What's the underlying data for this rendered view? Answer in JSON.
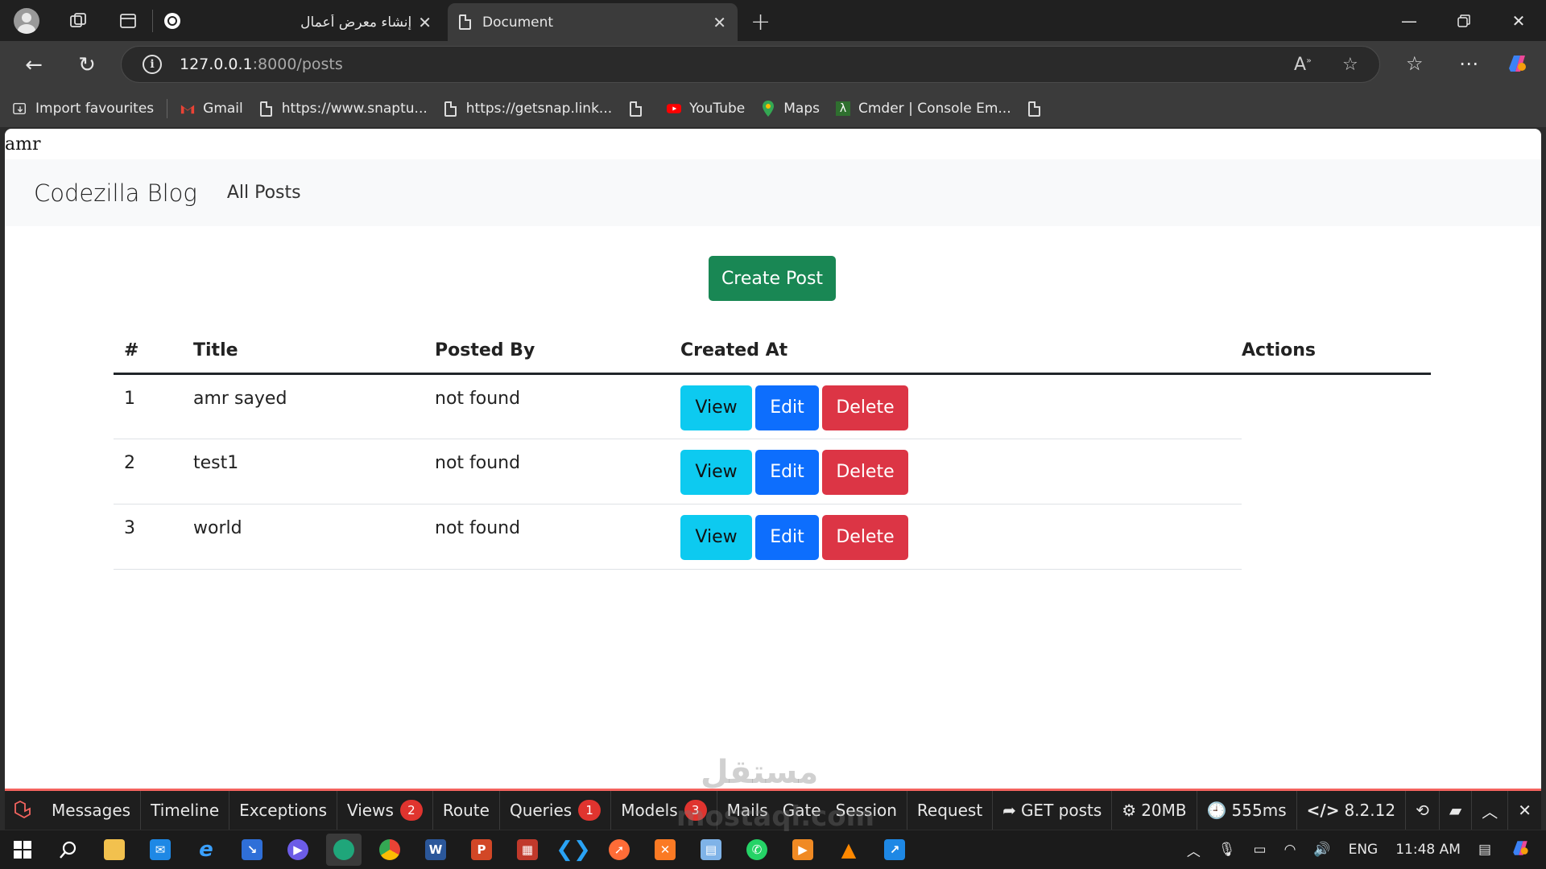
{
  "browser": {
    "tabs": [
      {
        "label": "إنشاء معرض أعمال",
        "active": false
      },
      {
        "label": "Document",
        "active": true
      }
    ],
    "url": {
      "host": "127.0.0.1",
      "path": ":8000/posts"
    },
    "bookmarks": [
      {
        "label": "Import favourites",
        "icon": "import-icon"
      },
      {
        "label": "Gmail",
        "icon": "gmail-icon"
      },
      {
        "label": "https://www.snaptu...",
        "icon": "page-icon"
      },
      {
        "label": "https://getsnap.link...",
        "icon": "page-icon"
      },
      {
        "label": "",
        "icon": "page-icon"
      },
      {
        "label": "YouTube",
        "icon": "youtube-icon"
      },
      {
        "label": "Maps",
        "icon": "maps-icon"
      },
      {
        "label": "Cmder | Console Em...",
        "icon": "cmder-icon"
      },
      {
        "label": "",
        "icon": "page-icon"
      }
    ]
  },
  "page": {
    "raw_text": "amr",
    "navbar": {
      "brand": "Codezilla Blog",
      "link": "All Posts"
    },
    "create_button": "Create Post",
    "table": {
      "headers": {
        "num": "#",
        "title": "Title",
        "posted_by": "Posted By",
        "created_at": "Created At",
        "actions": "Actions"
      },
      "rows": [
        {
          "num": "1",
          "title": "amr sayed",
          "posted_by": "not found"
        },
        {
          "num": "2",
          "title": "test1",
          "posted_by": "not found"
        },
        {
          "num": "3",
          "title": "world",
          "posted_by": "not found"
        }
      ],
      "action_labels": {
        "view": "View",
        "edit": "Edit",
        "delete": "Delete"
      }
    }
  },
  "debugbar": {
    "items": [
      {
        "label": "Messages",
        "badge": ""
      },
      {
        "label": "Timeline",
        "badge": ""
      },
      {
        "label": "Exceptions",
        "badge": ""
      },
      {
        "label": "Views",
        "badge": "2"
      },
      {
        "label": "Route",
        "badge": ""
      },
      {
        "label": "Queries",
        "badge": "1"
      },
      {
        "label": "Models",
        "badge": "3"
      },
      {
        "label": "Mails",
        "badge": ""
      },
      {
        "label": "Gate",
        "badge": ""
      },
      {
        "label": "Session",
        "badge": ""
      },
      {
        "label": "Request",
        "badge": ""
      }
    ],
    "request": "GET posts",
    "memory": "20MB",
    "time": "555ms",
    "php_version": "8.2.12"
  },
  "taskbar": {
    "language": "ENG",
    "time": "11:48 AM"
  },
  "watermark": {
    "line1": "مستقل",
    "line2": "mostaql.com"
  },
  "colors": {
    "create": "#198754",
    "view": "#0dcaf0",
    "edit": "#0d6efd",
    "delete": "#dc3545",
    "debug_accent": "#f4645f"
  }
}
